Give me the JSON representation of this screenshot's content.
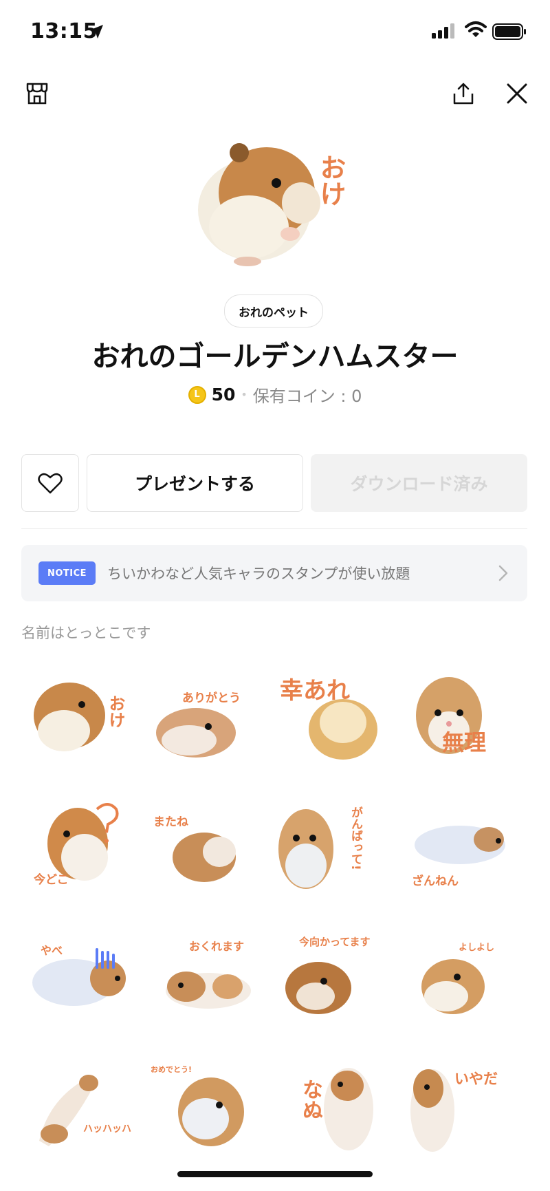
{
  "status_bar": {
    "time": "13:15"
  },
  "header": {
    "shop_icon": "shop-icon",
    "share_icon": "share-icon",
    "close_icon": "close-icon"
  },
  "product": {
    "hero_caption": "おけ",
    "category": "おれのペット",
    "title": "おれのゴールデンハムスター",
    "coin_symbol": "L",
    "price": "50",
    "separator": "•",
    "owned_coins": "保有コイン : 0"
  },
  "actions": {
    "like_icon": "heart-icon",
    "gift_label": "プレゼントする",
    "download_label": "ダウンロード済み"
  },
  "notice": {
    "tag": "NOTICE",
    "text": "ちいかわなど人気キャラのスタンプが使い放題"
  },
  "section_label": "名前はとっとこです",
  "stickers": [
    {
      "caption": "おけ"
    },
    {
      "caption": "ありがとう"
    },
    {
      "caption": "幸あれ"
    },
    {
      "caption": "無理"
    },
    {
      "caption": "今どこ"
    },
    {
      "caption": "またね"
    },
    {
      "caption": "がんばって!"
    },
    {
      "caption": "ざんねん"
    },
    {
      "caption": "やべ"
    },
    {
      "caption": "おくれます"
    },
    {
      "caption": "今向かってます"
    },
    {
      "caption": "よしよし"
    },
    {
      "caption": "ハッハッハ"
    },
    {
      "caption": "おめでとう!"
    },
    {
      "caption": "なぬ"
    },
    {
      "caption": "いやだ"
    }
  ]
}
